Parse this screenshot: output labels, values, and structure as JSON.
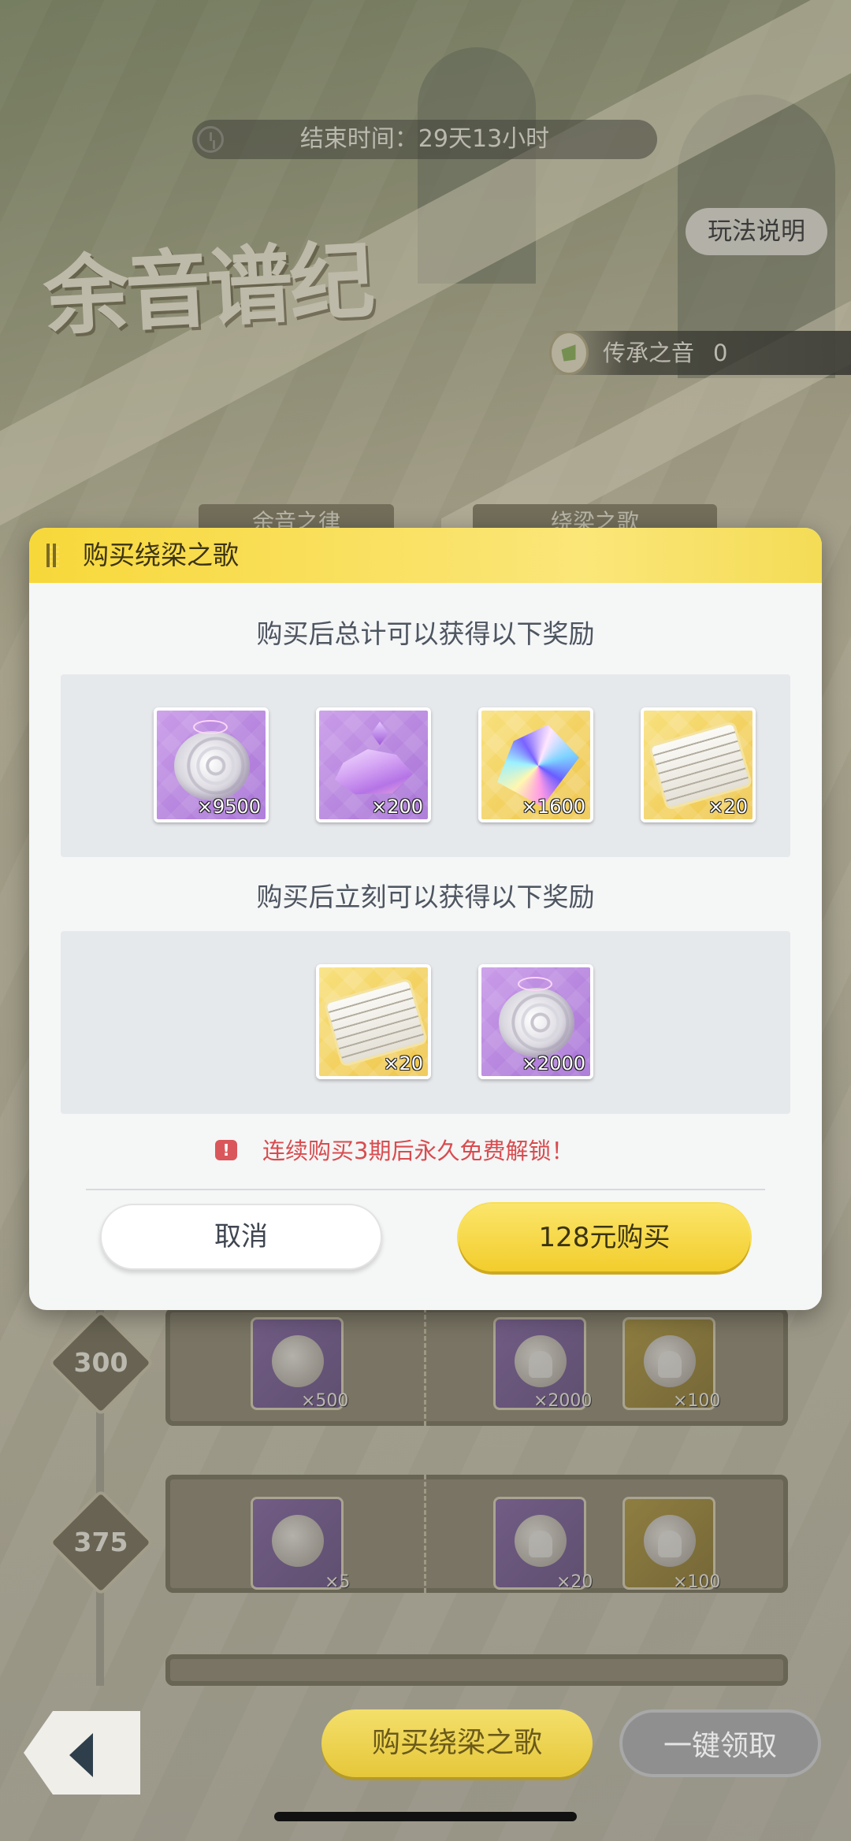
{
  "event": {
    "timer_text": "结束时间：29天13小时",
    "logo_text": "余音谱纪",
    "rules_label": "玩法说明",
    "currency_label": "传承之音",
    "currency_value": "0",
    "tabs": [
      "余音之律",
      "绕梁之歌"
    ]
  },
  "modal": {
    "title": "购买绕梁之歌",
    "total_section_title": "购买后总计可以获得以下奖励",
    "total_rewards": [
      {
        "item": "shell-fossil",
        "rarity": "purple",
        "qty": "×9500"
      },
      {
        "item": "purple-crystal",
        "rarity": "purple",
        "qty": "×200"
      },
      {
        "item": "prism-gem",
        "rarity": "gold",
        "qty": "×1600"
      },
      {
        "item": "music-scroll",
        "rarity": "gold",
        "qty": "×20"
      }
    ],
    "instant_section_title": "购买后立刻可以获得以下奖励",
    "instant_rewards": [
      {
        "item": "music-scroll",
        "rarity": "gold",
        "qty": "×20"
      },
      {
        "item": "shell-fossil",
        "rarity": "purple",
        "qty": "×2000"
      }
    ],
    "notice_icon": "!",
    "notice_text": "连续购买3期后永久免费解锁！",
    "cancel_label": "取消",
    "buy_label": "128元购买",
    "colors": {
      "header": "#f7d83a",
      "notice": "#d84c4f",
      "buy_button": "#f2cd2c"
    }
  },
  "levels": [
    {
      "level": "300",
      "free_qty": "×500",
      "paid_qty_1": "×2000",
      "paid_qty_2": "×100"
    },
    {
      "level": "375",
      "free_qty": "×5",
      "paid_qty_1": "×20",
      "paid_qty_2": "×100"
    }
  ],
  "bottom_bar": {
    "back_icon": "back-arrow-icon",
    "buy_label": "购买绕梁之歌",
    "claim_all_label": "一键领取"
  }
}
